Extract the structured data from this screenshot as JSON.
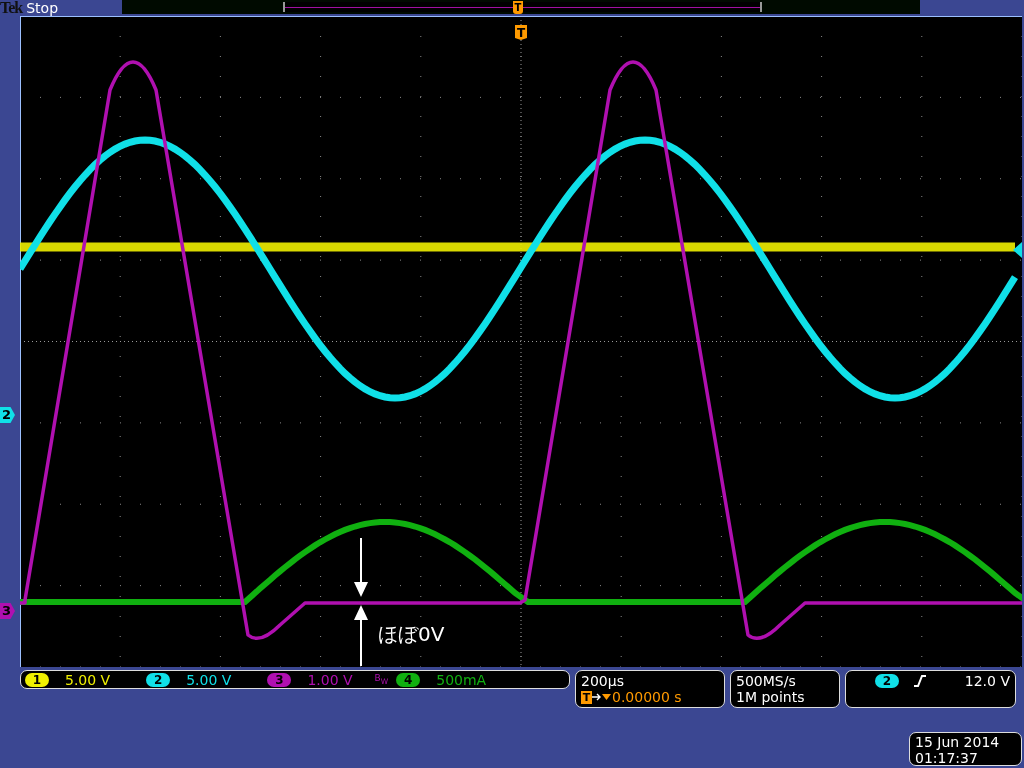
{
  "header": {
    "brand": "Tek",
    "status": "Stop",
    "trigger_label": "T"
  },
  "graticule": {
    "trigger_label": "T",
    "annotation": "ほぼ0V",
    "channel_markers": [
      {
        "label": "2",
        "color": "#10e0e8"
      },
      {
        "label": "3",
        "color": "#b010b0"
      }
    ]
  },
  "channels": [
    {
      "number": "1",
      "scale": "5.00 V",
      "color": "#f0f000"
    },
    {
      "number": "2",
      "scale": "5.00 V",
      "color": "#10e0e8"
    },
    {
      "number": "3",
      "scale": "1.00 V",
      "color": "#b010b0",
      "bw_label": "B$_{W}$"
    },
    {
      "number": "4",
      "scale": "500mA",
      "color": "#10b010"
    }
  ],
  "horizontal": {
    "scale": "200µs",
    "trigger_label": "T",
    "delay": "0.00000 s"
  },
  "acquisition": {
    "sample_rate": "500MS/s",
    "record_length": "1M points"
  },
  "trigger": {
    "source": "2",
    "color": "#10e0e8",
    "rising_edge": true,
    "level": "12.0 V"
  },
  "datetime": {
    "date": "15 Jun 2014",
    "time": "01:17:37"
  }
}
